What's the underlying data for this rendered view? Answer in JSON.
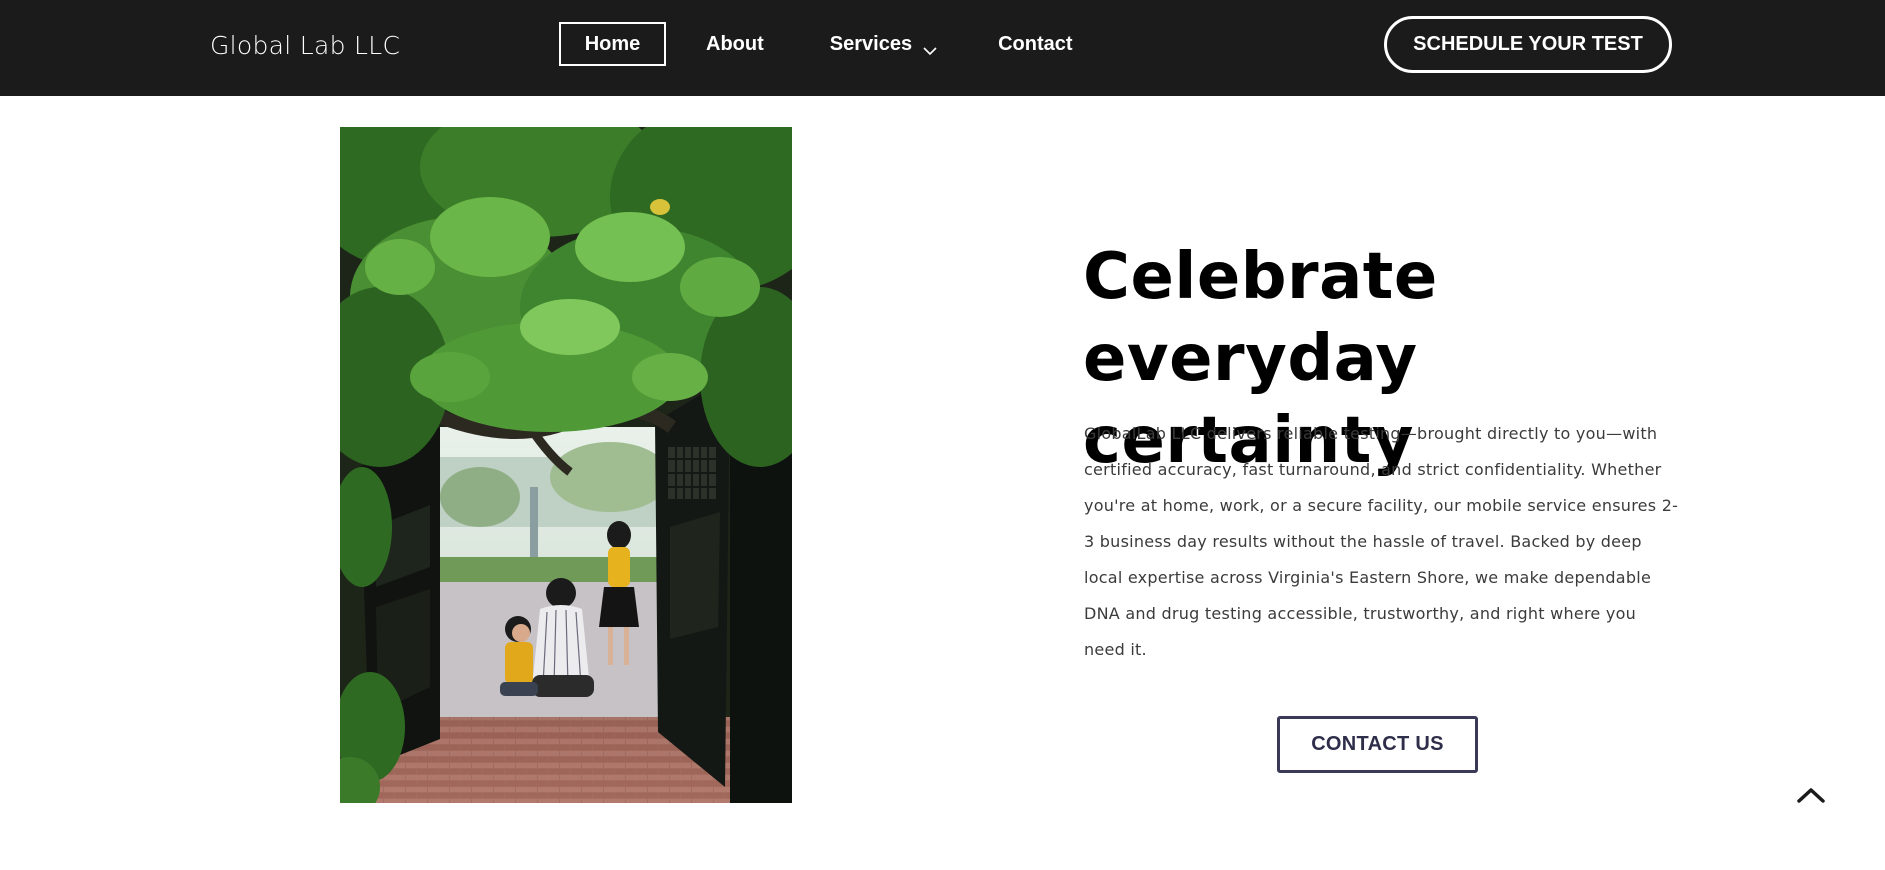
{
  "header": {
    "brand": "Global Lab LLC",
    "nav": [
      {
        "label": "Home",
        "active": true
      },
      {
        "label": "About"
      },
      {
        "label": "Services",
        "has_dropdown": true,
        "icon": "chevron-down-icon"
      },
      {
        "label": "Contact"
      }
    ],
    "cta_label": "SCHEDULE YOUR TEST",
    "background_color": "#1b1b1b"
  },
  "hero": {
    "image_description_icon": "photo",
    "title_line1": "Celebrate",
    "title_line2": "everyday certainty",
    "body": "GlobalLab LLC delivers reliable testing—brought directly to you—with certified accuracy, fast turnaround, and strict confidentiality. Whether you're at home, work, or a secure facility, our mobile service ensures 2-3 business day results without the hassle of travel. Backed by deep local expertise across Virginia's Eastern Shore, we make dependable DNA and drug testing accessible, trustworthy, and right where you need it.",
    "contact_button": "CONTACT US"
  },
  "back_to_top": {
    "icon": "chevron-up-icon"
  },
  "colors": {
    "accent_button_border": "#3a3a58",
    "text_dark": "#000000",
    "body_text": "#3b3b3b"
  }
}
